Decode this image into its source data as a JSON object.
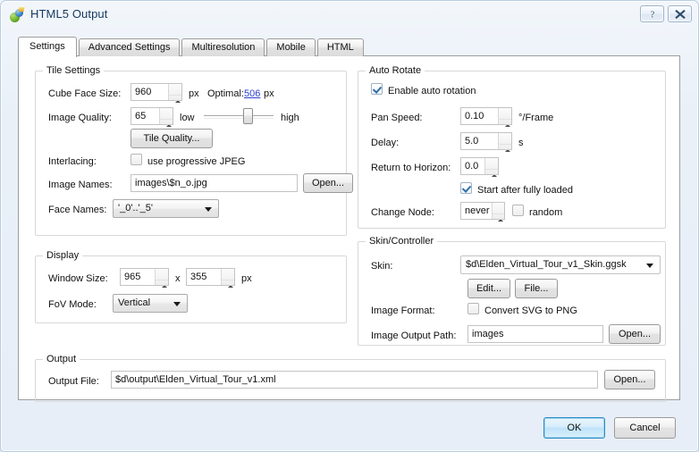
{
  "window": {
    "title": "HTML5 Output",
    "icon": "globe-sphere-icon",
    "help_button": "?",
    "close_button": "✖"
  },
  "tabs": [
    {
      "label": "Settings",
      "active": true
    },
    {
      "label": "Advanced Settings",
      "active": false
    },
    {
      "label": "Multiresolution",
      "active": false
    },
    {
      "label": "Mobile",
      "active": false
    },
    {
      "label": "HTML",
      "active": false
    }
  ],
  "tile_settings": {
    "legend": "Tile Settings",
    "cube_face_size_label": "Cube Face Size:",
    "cube_face_size_value": "960",
    "cube_face_size_unit": "px",
    "optimal_label": "Optimal:",
    "optimal_value": "506",
    "optimal_unit": "px",
    "image_quality_label": "Image Quality:",
    "image_quality_value": "65",
    "slider_low": "low",
    "slider_high": "high",
    "slider_percent": 65,
    "tile_quality_button": "Tile Quality...",
    "interlacing_label": "Interlacing:",
    "progressive_jpeg_label": "use progressive JPEG",
    "progressive_jpeg_checked": false,
    "image_names_label": "Image Names:",
    "image_names_value": "images\\$n_o.jpg",
    "image_names_open_button": "Open...",
    "face_names_label": "Face Names:",
    "face_names_value": "'_0'..'_5'"
  },
  "display": {
    "legend": "Display",
    "window_size_label": "Window Size:",
    "window_width": "965",
    "separator": "x",
    "window_height": "355",
    "unit": "px",
    "fov_mode_label": "FoV Mode:",
    "fov_mode_value": "Vertical"
  },
  "auto_rotate": {
    "legend": "Auto Rotate",
    "enable_label": "Enable auto rotation",
    "enable_checked": true,
    "pan_speed_label": "Pan Speed:",
    "pan_speed_value": "0.10",
    "pan_speed_unit": "°/Frame",
    "delay_label": "Delay:",
    "delay_value": "5.0",
    "delay_unit": "s",
    "return_horizon_label": "Return to Horizon:",
    "return_horizon_value": "0.0",
    "start_after_loaded_label": "Start after fully loaded",
    "start_after_loaded_checked": true,
    "change_node_label": "Change Node:",
    "change_node_value": "never",
    "random_label": "random",
    "random_checked": false
  },
  "skin_controller": {
    "legend": "Skin/Controller",
    "skin_label": "Skin:",
    "skin_value": "$d\\Elden_Virtual_Tour_v1_Skin.ggsk",
    "edit_button": "Edit...",
    "file_button": "File...",
    "image_format_label": "Image Format:",
    "convert_svg_label": "Convert SVG to PNG",
    "convert_svg_checked": false,
    "image_output_path_label": "Image Output Path:",
    "image_output_path_value": "images",
    "image_output_open_button": "Open..."
  },
  "output": {
    "legend": "Output",
    "output_file_label": "Output File:",
    "output_file_value": "$d\\output\\Elden_Virtual_Tour_v1.xml",
    "open_button": "Open..."
  },
  "footer": {
    "ok_button": "OK",
    "cancel_button": "Cancel"
  },
  "colors": {
    "accent": "#2a8cc4",
    "link": "#2a3fd0",
    "title_text": "#14385e"
  }
}
